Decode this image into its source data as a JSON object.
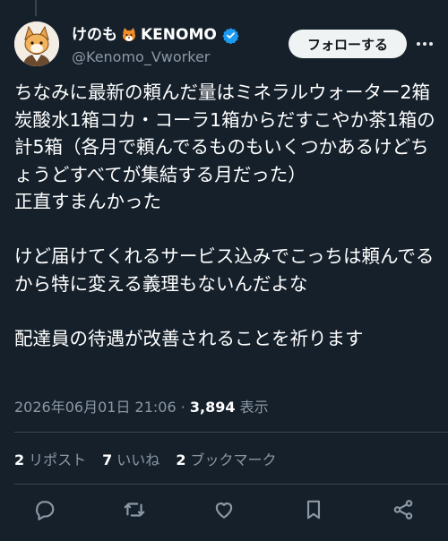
{
  "tweet": {
    "author": {
      "display_name_prefix": "けのも",
      "display_name_suffix": "KENOMO",
      "handle": "@Kenomo_Vworker",
      "verified": true
    },
    "follow_label": "フォローする",
    "text": "ちなみに最新の頼んだ量はミネラルウォーター2箱炭酸水1箱コカ・コーラ1箱からだすこやか茶1箱の計5箱（各月で頼んでるものもいくつかあるけどちょうどすべてが集結する月だった）\n正直すまんかった\n\nけど届けてくれるサービス込みでこっちは頼んでるから特に変える義理もないんだよな\n\n配達員の待遇が改善されることを祈ります",
    "timestamp": "2026年06月01日 21:06",
    "separator": "·",
    "views": "3,894",
    "views_label": "表示",
    "stats": {
      "reposts_count": "2",
      "reposts_label": "リポスト",
      "likes_count": "7",
      "likes_label": "いいね",
      "bookmarks_count": "2",
      "bookmarks_label": "ブックマーク"
    },
    "actions": [
      "reply-icon",
      "repost-icon",
      "like-icon",
      "bookmark-icon",
      "share-icon"
    ]
  },
  "colors": {
    "background": "#15202b",
    "text_primary": "#ffffff",
    "text_secondary": "#8b98a5",
    "divider": "#38444d",
    "verified": "#1d9bf0",
    "follow_button_bg": "#eff3f4"
  }
}
